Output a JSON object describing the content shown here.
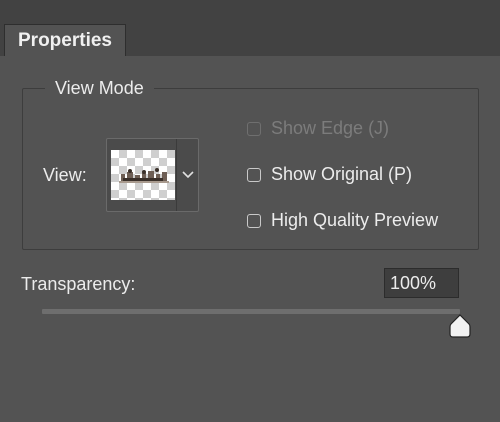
{
  "panel": {
    "tab_label": "Properties"
  },
  "view_mode": {
    "legend": "View Mode",
    "view_label": "View:",
    "thumbnail_icon": "transparency-checkerboard-thumbnail",
    "dropdown_icon": "chevron-down-icon"
  },
  "options": {
    "show_edge": {
      "label": "Show Edge (J)",
      "checked": false,
      "disabled": true
    },
    "show_original": {
      "label": "Show Original (P)",
      "checked": false,
      "disabled": false
    },
    "high_quality_preview": {
      "label": "High Quality Preview",
      "checked": false,
      "disabled": false
    }
  },
  "transparency": {
    "label": "Transparency:",
    "value": "100%",
    "fraction": 1.0
  },
  "colors": {
    "background": "#535353",
    "tabbar": "#424242",
    "text": "#ececec"
  }
}
